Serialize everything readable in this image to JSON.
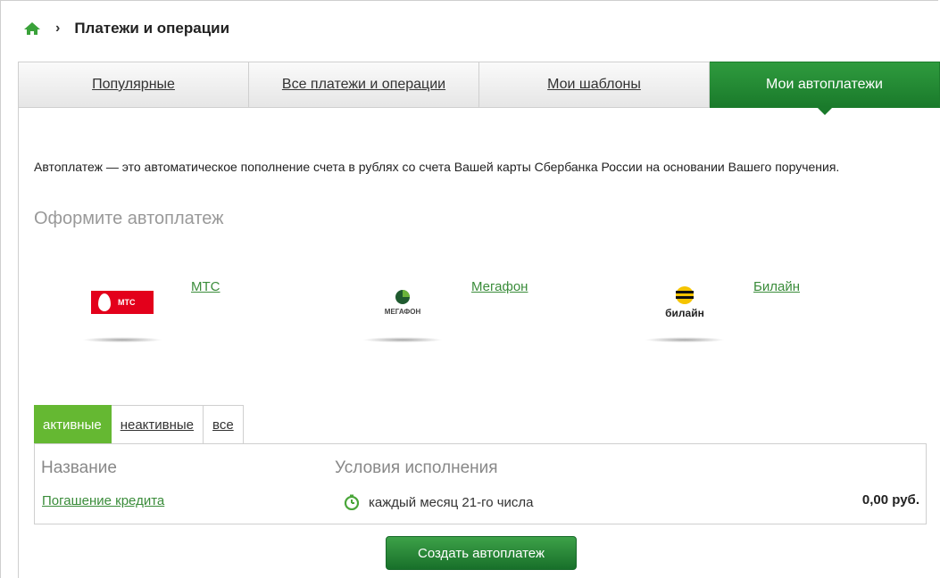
{
  "breadcrumb": {
    "title": "Платежи и операции"
  },
  "tabs": [
    {
      "label": "Популярные"
    },
    {
      "label": "Все платежи и операции"
    },
    {
      "label": "Мои шаблоны"
    },
    {
      "label": "Мои автоплатежи",
      "active": true
    }
  ],
  "description": "Автоплатеж — это автоматическое пополнение счета в рублях со счета Вашей карты Сбербанка России на основании Вашего поручения.",
  "subtitle": "Оформите автоплатеж",
  "providers": [
    {
      "name": "МТС",
      "logo_text": "МТС",
      "icon": "mts-logo"
    },
    {
      "name": "Мегафон",
      "logo_text": "МЕГАФОН",
      "icon": "megafon-logo"
    },
    {
      "name": "Билайн",
      "logo_text": "билайн",
      "icon": "beeline-logo"
    }
  ],
  "subtabs": [
    {
      "label": "активные",
      "active": true
    },
    {
      "label": "неактивные"
    },
    {
      "label": "все"
    }
  ],
  "table": {
    "headers": {
      "name": "Название",
      "conditions": "Условия исполнения"
    },
    "rows": [
      {
        "name": "Погашение кредита",
        "conditions": "каждый месяц 21-го числа",
        "amount": "0,00 руб."
      }
    ]
  },
  "create_button": "Создать автоплатеж",
  "colors": {
    "brand_green": "#1a7a2b",
    "active_subtab": "#65b832",
    "link": "#3a8c3a"
  }
}
